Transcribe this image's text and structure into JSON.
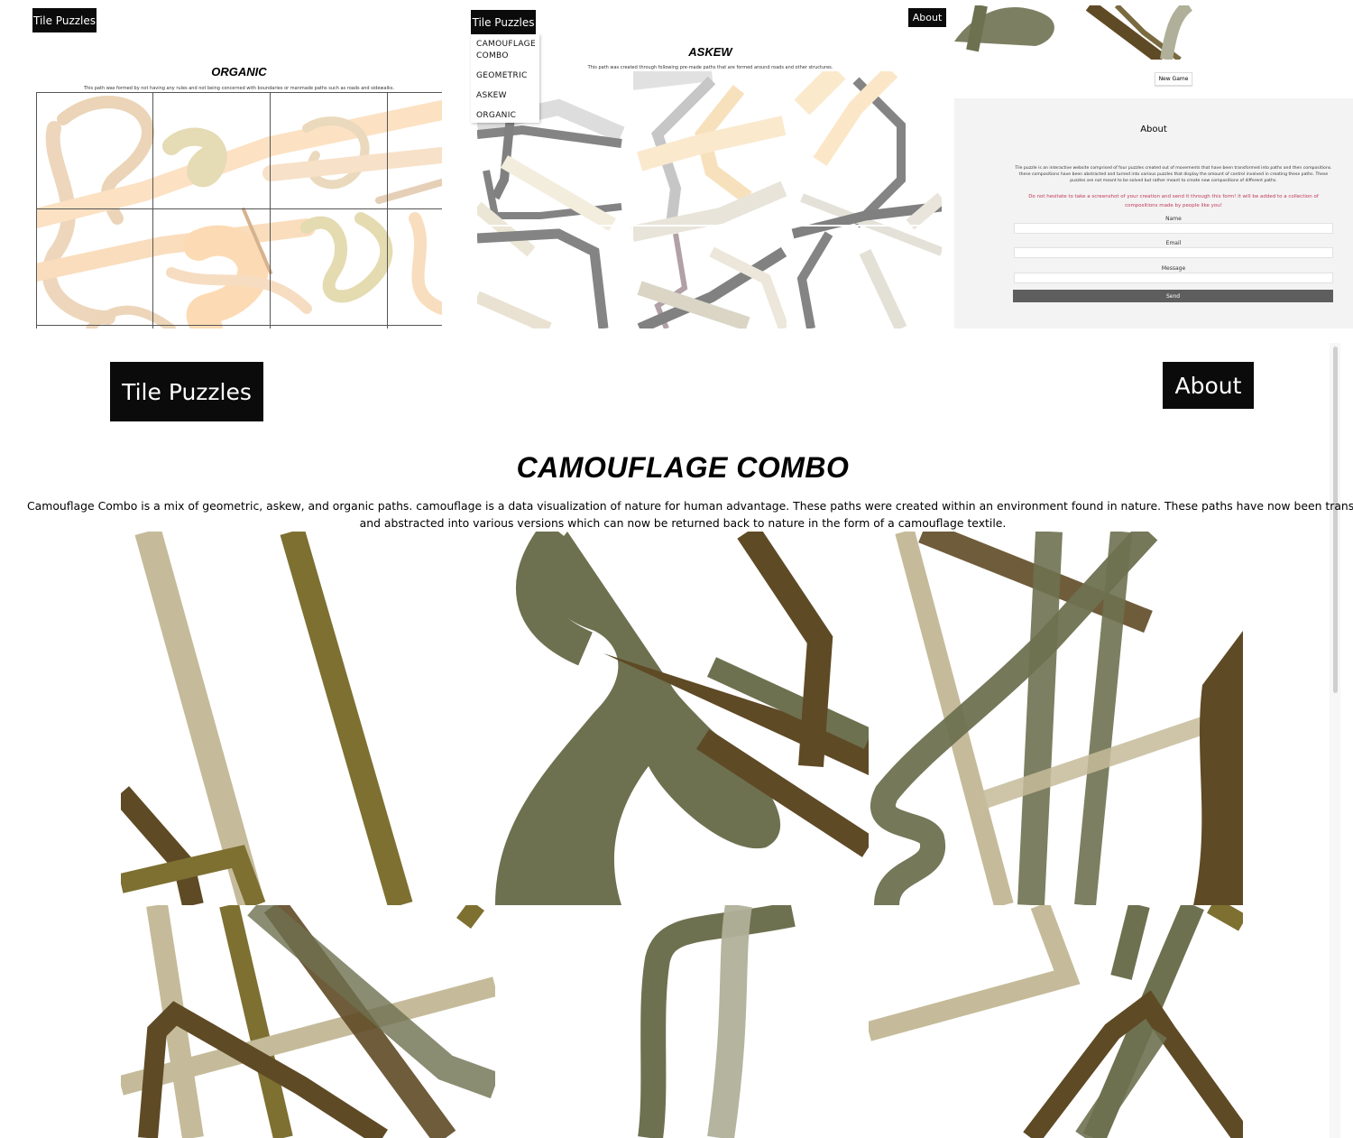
{
  "panel1": {
    "nav_title": "Tile Puzzles",
    "heading": "ORGANIC",
    "description": "This path was formed by not having any rules and not being concerned with boundaries or manmade paths such as roads and sidewalks."
  },
  "panel2": {
    "nav_title": "Tile Puzzles",
    "about_label": "About",
    "dropdown": [
      "CAMOUFLAGE COMBO",
      "GEOMETRIC",
      "ASKEW",
      "ORGANIC"
    ],
    "heading": "ASKEW",
    "description": "This path was created through following pre-made paths that are formed around roads and other structures."
  },
  "panel3": {
    "new_game_label": "New Game",
    "about_heading": "About",
    "about_text": "Tile puzzle is an interactive website comprised of four puzzles created out of movements that have been transformed into paths and then compositions. these compositions have been abstracted and turned into various puzzles that display the amount of control involved in creating these paths. These puzzles are not meant to be solved but rather meant to create new compositions of different paths.",
    "invite_text": "Do not hesitate to take a screenshot of your creation and send it through this form! it will be added to a collection of compositions made by people like you!",
    "form": {
      "name_label": "Name",
      "email_label": "Email",
      "message_label": "Message",
      "send_label": "Send"
    }
  },
  "main": {
    "nav_title": "Tile Puzzles",
    "about_label": "About",
    "heading": "CAMOUFLAGE COMBO",
    "description_line1": "Camouflage Combo is a mix of geometric, askew, and organic paths. camouflage is a data visualization of nature for human advantage. These paths were created within an environment found in nature. These paths have now been translated",
    "description_line2": "and abstracted into various versions which can now be returned back to nature in the form of a camouflage textile."
  },
  "colors": {
    "camo_khaki": "#c5bb9a",
    "camo_olive": "#7d7031",
    "camo_sage": "#6e7150",
    "camo_brown": "#5f4a26",
    "camo_grey": "#b0b09a",
    "askew_grey": "#6f6f6f",
    "organic_peach": "#f8d4aa",
    "organic_tan": "#e0d3a2",
    "invite_red": "#c0395a"
  }
}
